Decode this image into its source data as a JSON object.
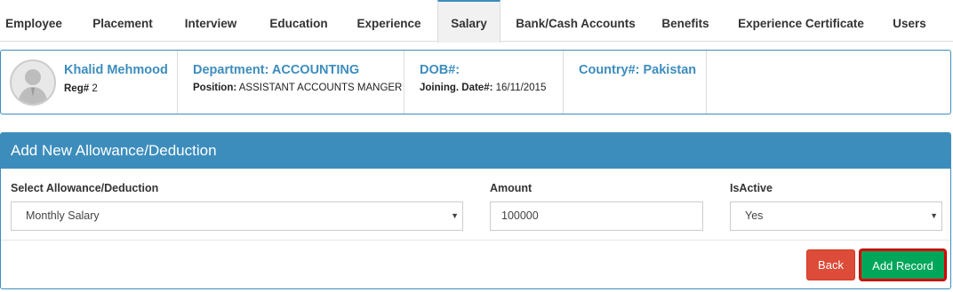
{
  "tabs": [
    {
      "label": "Employee",
      "active": false
    },
    {
      "label": "Placement",
      "active": false
    },
    {
      "label": "Interview",
      "active": false
    },
    {
      "label": "Education",
      "active": false
    },
    {
      "label": "Experience",
      "active": false
    },
    {
      "label": "Salary",
      "active": true
    },
    {
      "label": "Bank/Cash Accounts",
      "active": false
    },
    {
      "label": "Benefits",
      "active": false
    },
    {
      "label": "Experience Certificate",
      "active": false
    },
    {
      "label": "Users",
      "active": false
    }
  ],
  "profile": {
    "name": "Khalid Mehmood",
    "reg_label": "Reg#",
    "reg_value": "2",
    "department": "Department: ACCOUNTING",
    "position_label": "Position:",
    "position_value": "ASSISTANT ACCOUNTS MANGER",
    "dob": "DOB#:",
    "joining_label": "Joining. Date#:",
    "joining_value": "16/11/2015",
    "country": "Country#: Pakistan"
  },
  "form": {
    "title": "Add New Allowance/Deduction",
    "allowance_label": "Select Allowance/Deduction",
    "allowance_value": "Monthly Salary",
    "amount_label": "Amount",
    "amount_value": "100000",
    "isactive_label": "IsActive",
    "isactive_value": "Yes",
    "back_label": "Back",
    "add_label": "Add Record"
  },
  "icons": {
    "avatar": "user-avatar-icon",
    "caret": "caret-down-icon"
  },
  "colors": {
    "primary": "#3c8dbc",
    "danger": "#dd4b39",
    "success": "#00a65a",
    "highlight": "#e00000"
  }
}
